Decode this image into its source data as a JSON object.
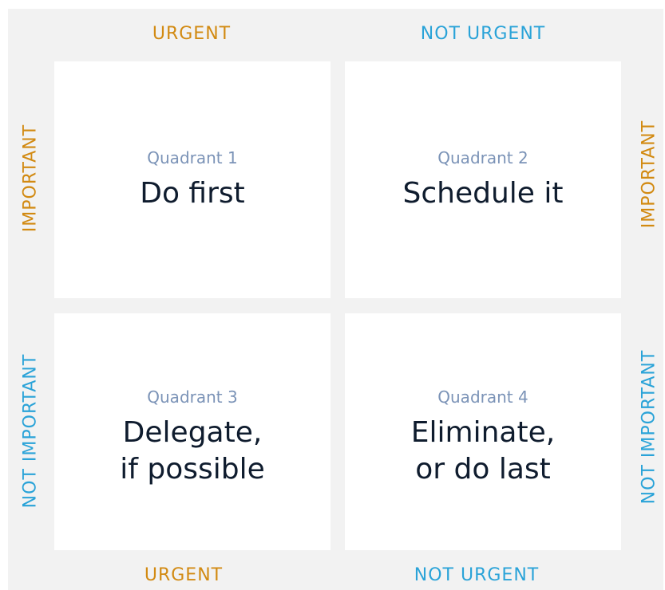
{
  "columns": {
    "top": [
      "URGENT",
      "NOT URGENT"
    ],
    "bottom": [
      "URGENT",
      "NOT URGENT"
    ]
  },
  "rows": {
    "left": [
      "IMPORTANT",
      "NOT IMPORTANT"
    ],
    "right": [
      "IMPORTANT",
      "NOT IMPORTANT"
    ]
  },
  "quadrants": [
    {
      "number": "Quadrant 1",
      "title_lines": [
        "Do first"
      ]
    },
    {
      "number": "Quadrant 2",
      "title_lines": [
        "Schedule it"
      ]
    },
    {
      "number": "Quadrant 3",
      "title_lines": [
        "Delegate,",
        "if possible"
      ]
    },
    {
      "number": "Quadrant 4",
      "title_lines": [
        "Eliminate,",
        "or do last"
      ]
    }
  ],
  "colors": {
    "urgent_important": "#d28a12",
    "not_urgent_not_important": "#2aa3d8",
    "quadrant_label": "#7b93b7",
    "quadrant_title": "#0f1c2e",
    "panel_background": "#f2f2f2"
  }
}
